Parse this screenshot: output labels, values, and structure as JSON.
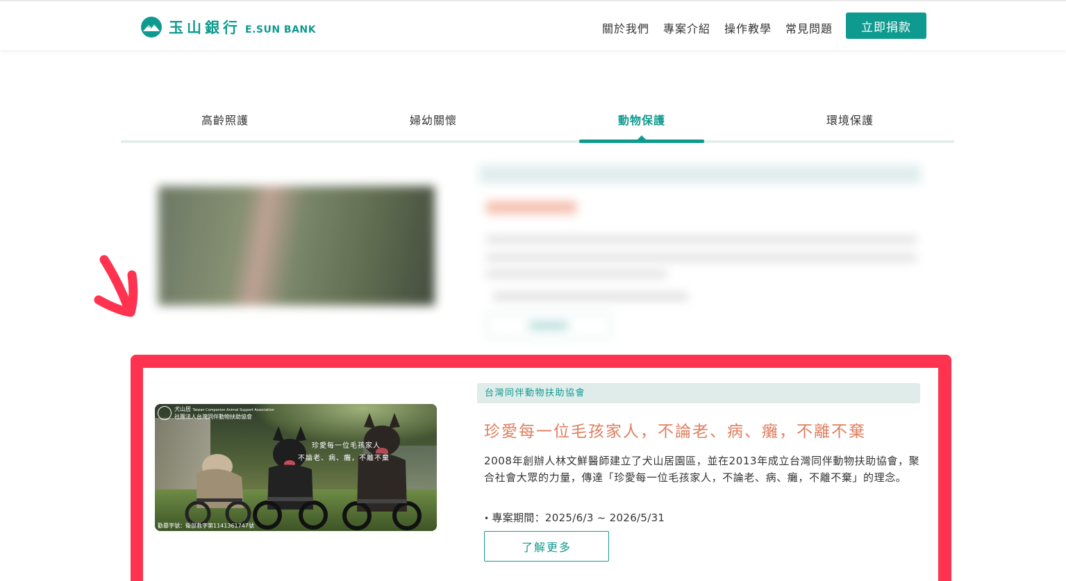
{
  "header": {
    "logo_zh": "玉山銀行",
    "logo_en": "E.SUN BANK",
    "logo_icon": "mountain-icon",
    "nav": [
      "關於我們",
      "專案介紹",
      "操作教學",
      "常見問題"
    ],
    "donate_label": "立即捐款"
  },
  "tabs": {
    "items": [
      "高齡照護",
      "婦幼關懷",
      "動物保護",
      "環境保護"
    ],
    "active": "動物保護"
  },
  "featured_project": {
    "org_tag": "台灣同伴動物扶助協會",
    "title": "珍愛每一位毛孩家人，不論老、病、癱，不離不棄",
    "description": "2008年創辦人林文鮮醫師建立了犬山居園區，並在2013年成立台灣同伴動物扶助協會，聚合社會大眾的力量，傳達「珍愛每一位毛孩家人，不論老、病、癱，不離不棄」的理念。",
    "period_label": "專案期間：2025/6/3 ~ 2026/5/31",
    "more_label": "了解更多",
    "photo": {
      "brand_name": "犬山居",
      "brand_en": "Taiwan Companion Animal Support Association",
      "brand_org": "社團法人台灣同伴動物扶助協會",
      "slogan_line1": "珍愛每一位毛孩家人",
      "slogan_line2": "不論老、病、癱，不離不棄",
      "footer": "勸募字號：衛部救字第1141361747號"
    }
  },
  "colors": {
    "brand": "#0f9a8f",
    "title_accent": "#e07e5f",
    "annotation": "#ff334f",
    "tag_bg": "#dfecea"
  }
}
